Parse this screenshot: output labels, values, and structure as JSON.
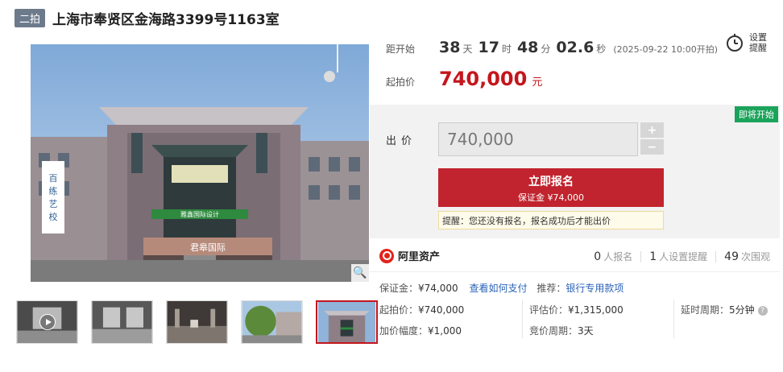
{
  "title": {
    "badge": "二拍",
    "text": "上海市奉贤区金海路3399号1163室"
  },
  "countdown": {
    "label": "距开始",
    "days": "38",
    "days_unit": "天",
    "hours": "17",
    "hours_unit": "时",
    "minutes": "48",
    "minutes_unit": "分",
    "seconds": "02.6",
    "seconds_unit": "秒",
    "start_note": "(2025-09-22 10:00开拍)"
  },
  "start_price": {
    "label": "起拍价",
    "value": "740,000",
    "unit": "元"
  },
  "reminder": {
    "label": "设置提醒",
    "icon": "alarm-clock-icon"
  },
  "bid": {
    "status_tag": "即将开始",
    "label": "出价",
    "input_value": "740,000",
    "plus": "+",
    "minus": "−",
    "signup_label": "立即报名",
    "deposit_note": "保证金 ¥74,000",
    "tip": "提醒：您还没有报名，报名成功后才能出价"
  },
  "platform": {
    "name": "阿里资产",
    "stats": [
      {
        "num": "0",
        "label": "人报名"
      },
      {
        "num": "1",
        "label": "人设置提醒"
      },
      {
        "num": "49",
        "label": "次围观"
      }
    ]
  },
  "details": {
    "deposit_label": "保证金：",
    "deposit_value": "¥74,000",
    "how_to_pay": "查看如何支付",
    "recommend_label": "推荐：",
    "recommend_value": "银行专用款项",
    "start_price_label": "起拍价：",
    "start_price_value": "¥740,000",
    "increment_label": "加价幅度：",
    "increment_value": "¥1,000",
    "appraisal_label": "评估价：",
    "appraisal_value": "¥1,315,000",
    "bid_cycle_label": "竞价周期：",
    "bid_cycle_value": "3天",
    "delay_label": "延时周期：",
    "delay_value": "5分钟"
  },
  "image": {
    "sign_left": "百练艺校",
    "sign_banner": "君皋国际",
    "sign_center": "雅鑫国际设计"
  },
  "colors": {
    "accent": "#c4161c",
    "button": "#c1242e",
    "tag_green": "#1aa35a",
    "link": "#2a63b8"
  }
}
